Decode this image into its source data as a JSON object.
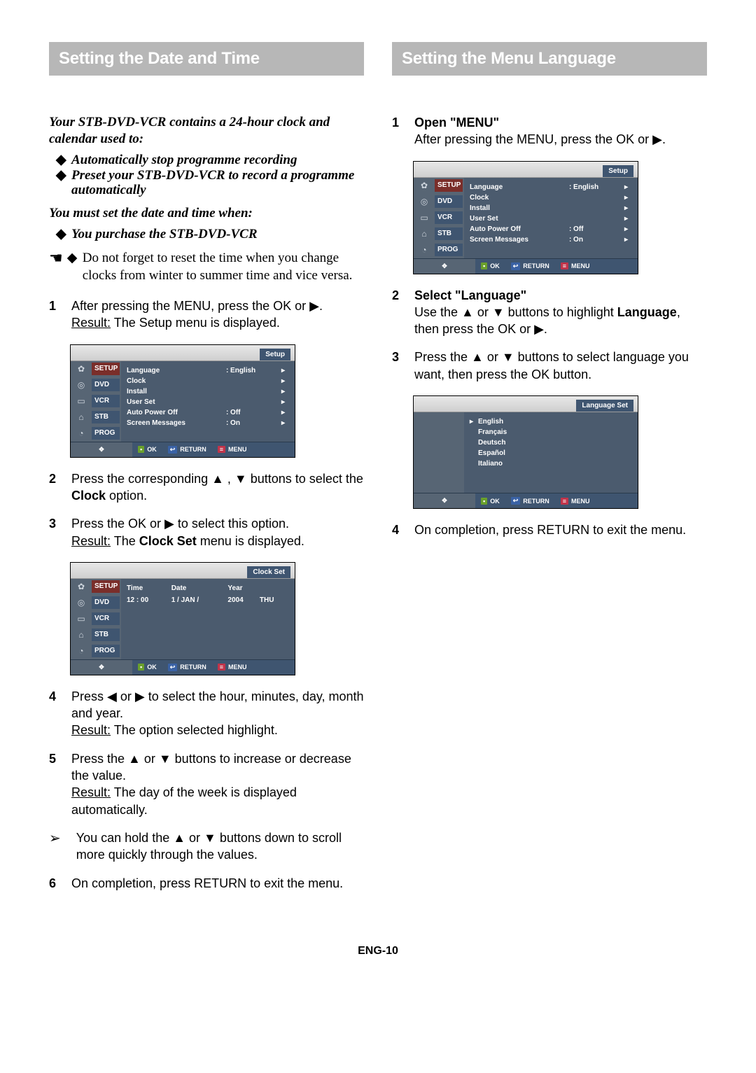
{
  "left": {
    "title": "Setting the Date and Time",
    "intro": "Your STB-DVD-VCR contains a 24-hour clock and calendar used to:",
    "bullets_em": [
      "Automatically stop programme recording",
      "Preset your STB-DVD-VCR to record a programme automatically"
    ],
    "when_intro": "You must set the date and time when:",
    "when_bullet_em": "You purchase the STB-DVD-VCR",
    "when_bullet_plain": "Do not forget to reset the time when you change clocks from winter to summer time and vice versa.",
    "step1a": "After pressing the MENU, press the OK or ▶.",
    "step1b_label": "Result:",
    "step1b": " The Setup menu is displayed.",
    "step2a": "Press the corresponding ▲ , ▼ buttons to select the ",
    "step2b": "Clock",
    "step2c": " option.",
    "step3a": "Press the OK or ▶ to select this option.",
    "step3b_label": "Result:",
    "step3b": " The ",
    "step3b_bold": "Clock Set",
    "step3b_tail": " menu is displayed.",
    "step4a": "Press ◀ or ▶ to select the hour, minutes, day, month and year.",
    "step4b_label": "Result:",
    "step4b": " The option selected highlight.",
    "step5a": "Press the ▲ or ▼ buttons to increase or decrease the value.",
    "step5b_label": "Result:",
    "step5b": " The day of the week is displayed automatically.",
    "note": "You can hold the ▲ or ▼ buttons down to scroll more quickly through the values.",
    "step6": "On completion, press RETURN to exit the menu."
  },
  "right": {
    "title": "Setting the Menu Language",
    "step1_head": "Open \"MENU\"",
    "step1_body": "After pressing the MENU, press the OK or ▶.",
    "step2_head": "Select \"Language\"",
    "step2a": "Use the ▲ or ▼ buttons to highlight ",
    "step2b": "Language",
    "step2c": ", then press the OK or ▶.",
    "step3": "Press the ▲ or ▼ buttons to select language you want, then press the OK button.",
    "step4": "On completion, press RETURN to exit the menu."
  },
  "osd_setup": {
    "title": "Setup",
    "tabs": [
      "SETUP",
      "DVD",
      "VCR",
      "STB",
      "PROG"
    ],
    "rows": [
      {
        "label": "Language",
        "val": ": English"
      },
      {
        "label": "Clock",
        "val": ""
      },
      {
        "label": "Install",
        "val": ""
      },
      {
        "label": "User Set",
        "val": ""
      },
      {
        "label": "Auto Power Off",
        "val": ": Off"
      },
      {
        "label": "Screen Messages",
        "val": ": On"
      }
    ],
    "foot": {
      "ok": "OK",
      "ret": "RETURN",
      "menu": "MENU"
    }
  },
  "osd_clock": {
    "title": "Clock Set",
    "tabs": [
      "SETUP",
      "DVD",
      "VCR",
      "STB",
      "PROG"
    ],
    "hdr": [
      "Time",
      "Date",
      "Year",
      ""
    ],
    "row": [
      "12 : 00",
      "1 / JAN /",
      "2004",
      "THU"
    ],
    "foot": {
      "ok": "OK",
      "ret": "RETURN",
      "menu": "MENU"
    }
  },
  "osd_lang": {
    "title": "Language Set",
    "langs": [
      "English",
      "Français",
      "Deutsch",
      "Español",
      "Italiano"
    ],
    "foot": {
      "ok": "OK",
      "ret": "RETURN",
      "menu": "MENU"
    }
  },
  "page_num": "ENG-10"
}
